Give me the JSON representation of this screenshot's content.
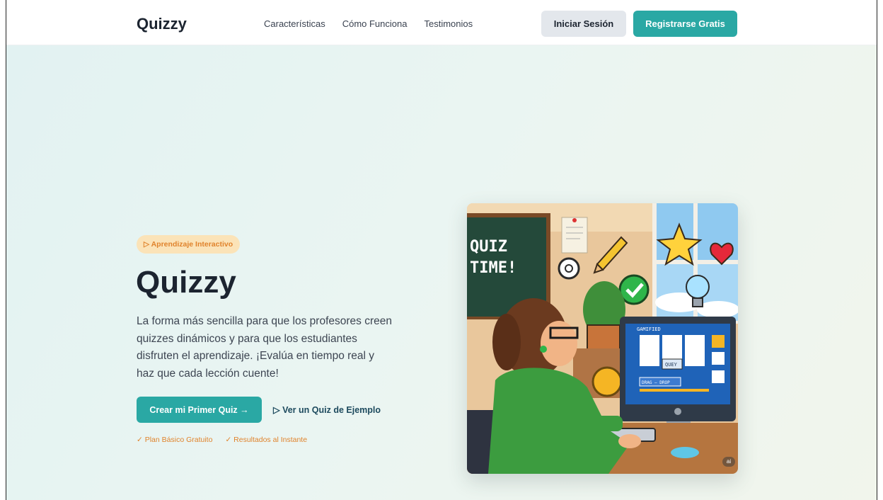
{
  "header": {
    "logo": "Quizzy",
    "nav": [
      "Características",
      "Cómo Funciona",
      "Testimonios"
    ],
    "login_label": "Iniciar Sesión",
    "register_label": "Registrarse Gratis"
  },
  "hero": {
    "badge": "▷ Aprendizaje Interactivo",
    "title": "Quizzy",
    "description": "La forma más sencilla para que los profesores creen quizzes dinámicos y para que los estudiantes disfruten el aprendizaje. ¡Evalúa en tiempo real y haz que cada lección cuente!",
    "primary_cta": "Crear mi Primer Quiz →",
    "secondary_cta": "▷ Ver un Quiz de Ejemplo",
    "perks": [
      "✓ Plan Básico Gratuito",
      "✓ Resultados al Instante"
    ]
  },
  "illustration": {
    "board_text_1": "QUIZ",
    "board_text_2": "TIME!",
    "screen_title": "GAMIFIED",
    "screen_button": "DRAG — DROP",
    "screen_label": "QUEY",
    "ai_badge": "ai"
  },
  "colors": {
    "accent": "#2aa8a4",
    "orange": "#e0832c",
    "dark": "#1c2430"
  }
}
